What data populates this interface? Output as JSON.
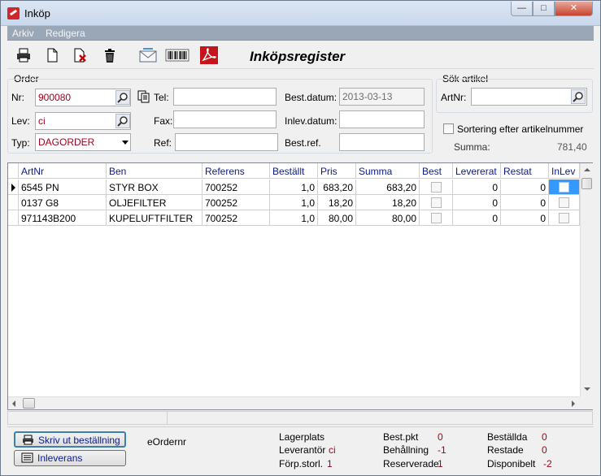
{
  "window": {
    "title": "Inköp"
  },
  "menu": [
    "Arkiv",
    "Redigera"
  ],
  "toolbar": {
    "title": "Inköpsregister"
  },
  "order": {
    "section_label": "Order",
    "nr_label": "Nr:",
    "nr_value": "900080",
    "lev_label": "Lev:",
    "lev_value": "ci",
    "typ_label": "Typ:",
    "typ_value": "DAGORDER",
    "tel_label": "Tel:",
    "tel_value": "",
    "fax_label": "Fax:",
    "fax_value": "",
    "ref_label": "Ref:",
    "ref_value": "",
    "bestdatum_label": "Best.datum:",
    "bestdatum_value": "2013-03-13",
    "inlevdatum_label": "Inlev.datum:",
    "inlevdatum_value": "",
    "bestref_label": "Best.ref.",
    "bestref_value": ""
  },
  "search": {
    "section_label": "Sök artikel",
    "artnr_label": "ArtNr:",
    "artnr_value": "",
    "sort_label": "Sortering efter artikelnummer",
    "summa_label": "Summa:",
    "summa_value": "781,40"
  },
  "grid": {
    "columns": [
      "ArtNr",
      "Ben",
      "Referens",
      "Beställt",
      "Pris",
      "Summa",
      "Best",
      "Levererat",
      "Restat",
      "InLev"
    ],
    "rows": [
      {
        "artnr": "6545 PN",
        "ben": "STYR BOX",
        "referens": "700252",
        "bestallt": "1,0",
        "pris": "683,20",
        "summa": "683,20",
        "levererat": "0",
        "restat": "0"
      },
      {
        "artnr": "0137 G8",
        "ben": "OLJEFILTER",
        "referens": "700252",
        "bestallt": "1,0",
        "pris": "18,20",
        "summa": "18,20",
        "levererat": "0",
        "restat": "0"
      },
      {
        "artnr": "971143B200",
        "ben": "KUPELUFTFILTER",
        "referens": "700252",
        "bestallt": "1,0",
        "pris": "80,00",
        "summa": "80,00",
        "levererat": "0",
        "restat": "0"
      }
    ]
  },
  "footer": {
    "print_button": "Skriv ut beställning",
    "inleverans_button": "Inleverans",
    "eordernr_label": "eOrdernr",
    "lagerplats_label": "Lagerplats",
    "leverantor_label": "Leverantör",
    "leverantor_value": "ci",
    "forpstorl_label": "Förp.storl.",
    "forpstorl_value": "1",
    "bestpkt_label": "Best.pkt",
    "bestpkt_value": "0",
    "behallning_label": "Behållning",
    "behallning_value": "-1",
    "reserverade_label": "Reserverade",
    "reserverade_value": "1",
    "bestallda_label": "Beställda",
    "bestallda_value": "0",
    "restade_label": "Restade",
    "restade_value": "0",
    "disponibelt_label": "Disponibelt",
    "disponibelt_value": "-2"
  }
}
